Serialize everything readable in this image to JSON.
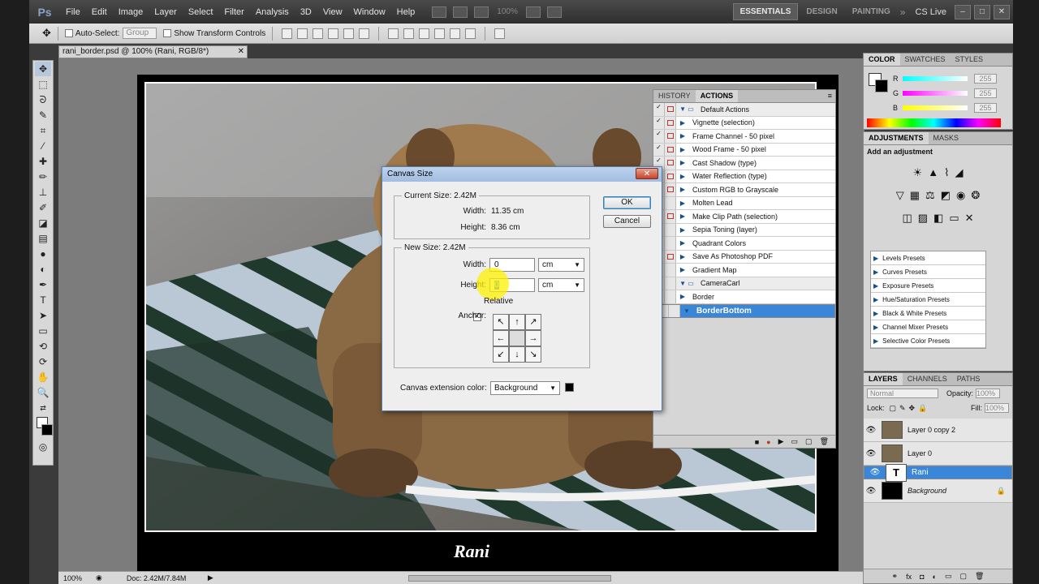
{
  "app": {
    "logo": "Ps"
  },
  "menubar": {
    "items": [
      "File",
      "Edit",
      "Image",
      "Layer",
      "Select",
      "Filter",
      "Analysis",
      "3D",
      "View",
      "Window",
      "Help"
    ],
    "zoom": "100%",
    "workspaces": [
      "ESSENTIALS",
      "DESIGN",
      "PAINTING"
    ],
    "cs_live": "CS Live"
  },
  "optbar": {
    "auto_select": "Auto-Select:",
    "group": "Group",
    "transform": "Show Transform Controls"
  },
  "document": {
    "tab_title": "rani_border.psd @ 100% (Rani, RGB/8*)",
    "signature": "Rani"
  },
  "statusbar": {
    "zoom": "100%",
    "doc": "Doc: 2.42M/7.84M"
  },
  "actions_panel": {
    "tabs": [
      "HISTORY",
      "ACTIONS"
    ],
    "rows": [
      {
        "label": "Default Actions",
        "type": "set"
      },
      {
        "label": "Vignette (selection)",
        "type": "action"
      },
      {
        "label": "Frame Channel - 50 pixel",
        "type": "action"
      },
      {
        "label": "Wood Frame - 50 pixel",
        "type": "action"
      },
      {
        "label": "Cast Shadow (type)",
        "type": "action"
      },
      {
        "label": "Water Reflection (type)",
        "type": "action"
      },
      {
        "label": "Custom RGB to Grayscale",
        "type": "action"
      },
      {
        "label": "Molten Lead",
        "type": "action"
      },
      {
        "label": "Make Clip Path (selection)",
        "type": "action"
      },
      {
        "label": "Sepia Toning (layer)",
        "type": "action"
      },
      {
        "label": "Quadrant Colors",
        "type": "action"
      },
      {
        "label": "Save As Photoshop PDF",
        "type": "action"
      },
      {
        "label": "Gradient Map",
        "type": "action"
      },
      {
        "label": "CameraCarl",
        "type": "set"
      },
      {
        "label": "Border",
        "type": "action"
      },
      {
        "label": "BorderBottom",
        "type": "selected"
      }
    ]
  },
  "color_panel": {
    "tabs": [
      "COLOR",
      "SWATCHES",
      "STYLES"
    ],
    "channels": [
      {
        "name": "R",
        "value": "255"
      },
      {
        "name": "G",
        "value": "255"
      },
      {
        "name": "B",
        "value": "255"
      }
    ]
  },
  "adjustments_panel": {
    "tabs": [
      "ADJUSTMENTS",
      "MASKS"
    ],
    "title": "Add an adjustment",
    "presets": [
      "Levels Presets",
      "Curves Presets",
      "Exposure Presets",
      "Hue/Saturation Presets",
      "Black & White Presets",
      "Channel Mixer Presets",
      "Selective Color Presets"
    ]
  },
  "layers_panel": {
    "tabs": [
      "LAYERS",
      "CHANNELS",
      "PATHS"
    ],
    "blend_mode": "Normal",
    "opacity_label": "Opacity:",
    "opacity": "100%",
    "lock_label": "Lock:",
    "fill_label": "Fill:",
    "fill": "100%",
    "layers": [
      {
        "name": "Layer 0 copy 2",
        "thumb": ""
      },
      {
        "name": "Layer 0",
        "thumb": ""
      },
      {
        "name": "Rani",
        "thumb": "T"
      },
      {
        "name": "Background",
        "thumb": ""
      }
    ]
  },
  "dialog": {
    "title": "Canvas Size",
    "current_size": "Current Size: 2.42M",
    "width_label": "Width:",
    "current_width": "11.35 cm",
    "height_label": "Height:",
    "current_height": "8.36 cm",
    "new_size": "New Size: 2.42M",
    "new_width": "0",
    "new_height": "0",
    "unit": "cm",
    "relative": "Relative",
    "anchor_label": "Anchor:",
    "ext_color_label": "Canvas extension color:",
    "ext_color": "Background",
    "ok": "OK",
    "cancel": "Cancel"
  }
}
